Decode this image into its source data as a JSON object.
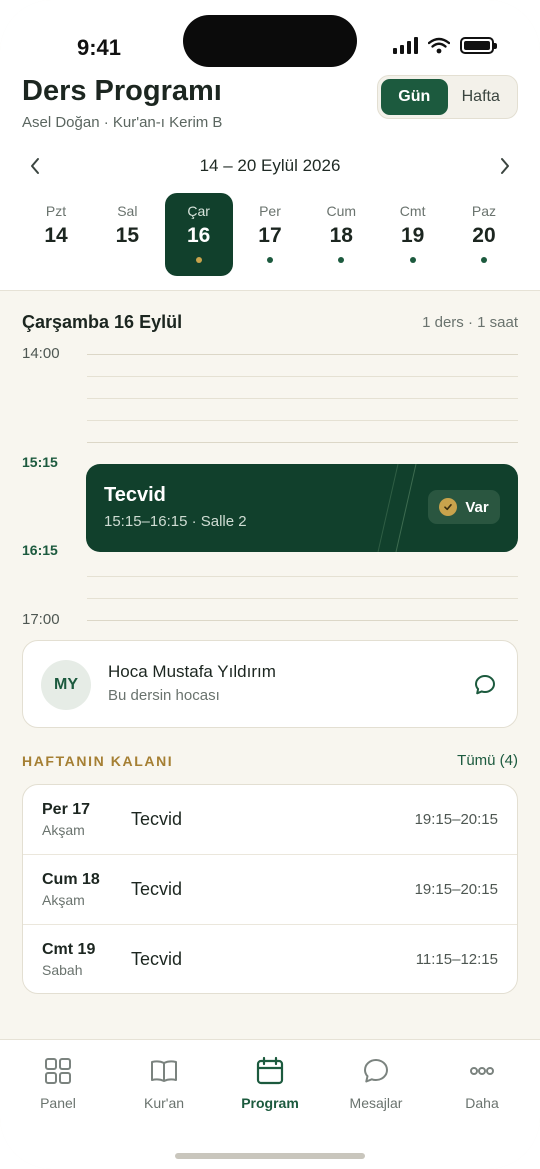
{
  "status": {
    "time": "9:41"
  },
  "header": {
    "title": "Ders Programı",
    "subtitle": "Asel Doğan · Kur'an-ı Kerim B",
    "view_day": "Gün",
    "view_week": "Hafta"
  },
  "week": {
    "range": "14 – 20 Eylül 2026",
    "days": [
      {
        "name": "Pzt",
        "num": "14",
        "has_lesson": false
      },
      {
        "name": "Sal",
        "num": "15",
        "has_lesson": false
      },
      {
        "name": "Çar",
        "num": "16",
        "has_lesson": true,
        "selected": true
      },
      {
        "name": "Per",
        "num": "17",
        "has_lesson": true
      },
      {
        "name": "Cum",
        "num": "18",
        "has_lesson": true
      },
      {
        "name": "Cmt",
        "num": "19",
        "has_lesson": true
      },
      {
        "name": "Paz",
        "num": "20",
        "has_lesson": true
      }
    ]
  },
  "schedule": {
    "date": "Çarşamba 16 Eylül",
    "meta": "1 ders · 1 saat",
    "times": [
      "14:00",
      "15:15",
      "16:15",
      "17:00"
    ],
    "lesson": {
      "title": "Tecvid",
      "detail": "15:15–16:15 · Salle 2",
      "badge": "Var"
    }
  },
  "teacher": {
    "initials": "MY",
    "name": "Hoca Mustafa Yıldırım",
    "role": "Bu dersin hocası"
  },
  "remaining": {
    "label": "HAFTANIN KALANI",
    "link": "Tümü (4)",
    "items": [
      {
        "day": "Per 17",
        "part": "Akşam",
        "lesson": "Tecvid",
        "time": "19:15–20:15"
      },
      {
        "day": "Cum 18",
        "part": "Akşam",
        "lesson": "Tecvid",
        "time": "19:15–20:15"
      },
      {
        "day": "Cmt 19",
        "part": "Sabah",
        "lesson": "Tecvid",
        "time": "11:15–12:15"
      }
    ]
  },
  "tabs": [
    {
      "label": "Panel",
      "icon": "grid-icon"
    },
    {
      "label": "Kur'an",
      "icon": "book-icon"
    },
    {
      "label": "Program",
      "icon": "calendar-icon",
      "active": true
    },
    {
      "label": "Mesajlar",
      "icon": "chat-icon"
    },
    {
      "label": "Daha",
      "icon": "more-icon"
    }
  ],
  "colors": {
    "primary": "#1c5a3e",
    "primary_dark": "#11402c",
    "accent_gold": "#c9a34c",
    "section_label": "#a57f33",
    "background": "#f8f6ef"
  }
}
